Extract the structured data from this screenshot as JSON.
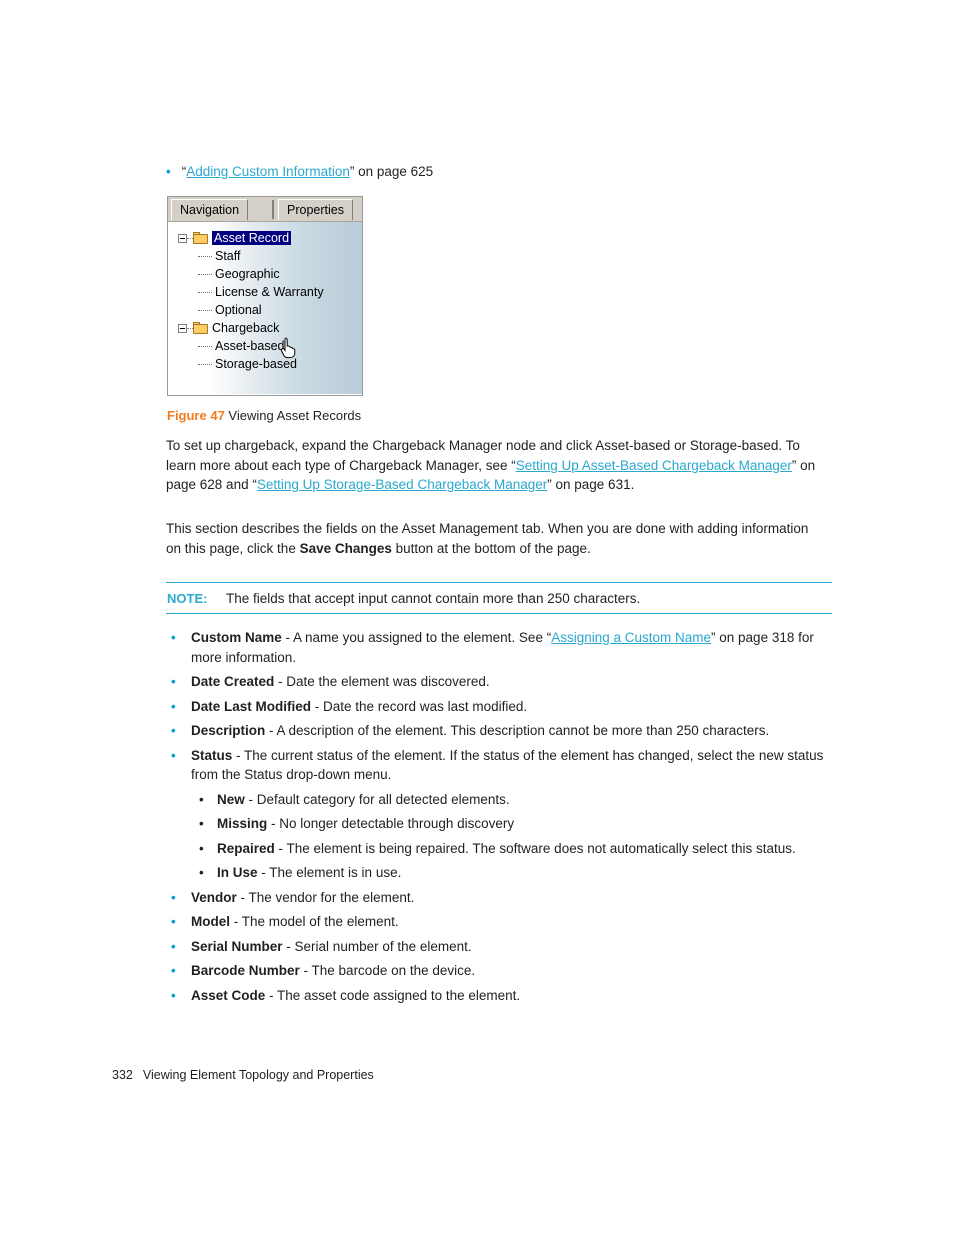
{
  "top_bullet": {
    "quote_open": "“",
    "link_text": "Adding Custom Information",
    "quote_close": "”",
    "tail": " on page 625"
  },
  "figure": {
    "tabs": [
      {
        "label": "Navigation",
        "active": true
      },
      {
        "label": "Properties",
        "active": false
      }
    ],
    "tree": [
      {
        "label": "Asset Record",
        "type": "folder",
        "selected": true,
        "expanded": true
      },
      {
        "label": "Staff",
        "type": "leaf"
      },
      {
        "label": "Geographic",
        "type": "leaf"
      },
      {
        "label": "License & Warranty",
        "type": "leaf"
      },
      {
        "label": "Optional",
        "type": "leaf"
      },
      {
        "label": "Chargeback",
        "type": "folder",
        "selected": false,
        "expanded": true
      },
      {
        "label": "Asset-based",
        "type": "leaf"
      },
      {
        "label": "Storage-based",
        "type": "leaf"
      }
    ],
    "cursor": "pointing-hand-cursor",
    "selection_color": "#000080",
    "folder_color": "#ffcc66"
  },
  "figure_caption": {
    "number": "Figure 47",
    "title": "Viewing Asset Records"
  },
  "paragraph_1": {
    "part1": "To set up chargeback, expand the Chargeback Manager node and click Asset-based or Storage-based. To learn more about each type of Chargeback Manager, see “",
    "link1": "Setting Up Asset-Based Chargeback Manager",
    "part2": "” on page 628 and “",
    "link2": "Setting Up Storage-Based Chargeback Manager",
    "part3": "” on page 631."
  },
  "paragraph_2": {
    "part1": "This section describes the fields on the Asset Management tab. When you are done with adding information on this page, click the ",
    "bold1": "Save Changes",
    "part2": " button at the bottom of the page."
  },
  "note": {
    "label": "NOTE:",
    "text": "The fields that accept input cannot contain more than 250 characters.",
    "rule_color": "#2aa8cf"
  },
  "fields": [
    {
      "term": "Custom Name",
      "text_before": " - A name you assigned to the element. See “",
      "link": "Assigning a Custom Name",
      "text_after": "” on page 318 for more information."
    },
    {
      "term": "Date Created",
      "text_before": " - Date the element was discovered.",
      "link": "",
      "text_after": ""
    },
    {
      "term": "Date Last Modified",
      "text_before": " - Date the record was last modified.",
      "link": "",
      "text_after": ""
    },
    {
      "term": "Description",
      "text_before": " - A description of the element. This description cannot be more than 250 characters.",
      "link": "",
      "text_after": ""
    },
    {
      "term": "Status",
      "text_before": " - The current status of the element. If the status of the element has changed, select the new status from the Status drop-down menu.",
      "link": "",
      "text_after": "",
      "sub_items": [
        {
          "term": "New",
          "text": " - Default category for all detected elements."
        },
        {
          "term": "Missing",
          "text": " - No longer detectable through discovery"
        },
        {
          "term": "Repaired",
          "text": " - The element is being repaired. The software does not automatically select this status."
        },
        {
          "term": "In Use",
          "text": " - The element is in use."
        }
      ]
    },
    {
      "term": "Vendor",
      "text_before": " - The vendor for the element.",
      "link": "",
      "text_after": ""
    },
    {
      "term": "Model",
      "text_before": " - The model of the element.",
      "link": "",
      "text_after": ""
    },
    {
      "term": "Serial Number",
      "text_before": " - Serial number of the element.",
      "link": "",
      "text_after": ""
    },
    {
      "term": "Barcode Number",
      "text_before": " - The barcode on the device.",
      "link": "",
      "text_after": ""
    },
    {
      "term": "Asset Code",
      "text_before": " - The asset code assigned to the element.",
      "link": "",
      "text_after": ""
    }
  ],
  "footer": {
    "page_number": "332",
    "chapter_title": "Viewing Element Topology and Properties"
  }
}
